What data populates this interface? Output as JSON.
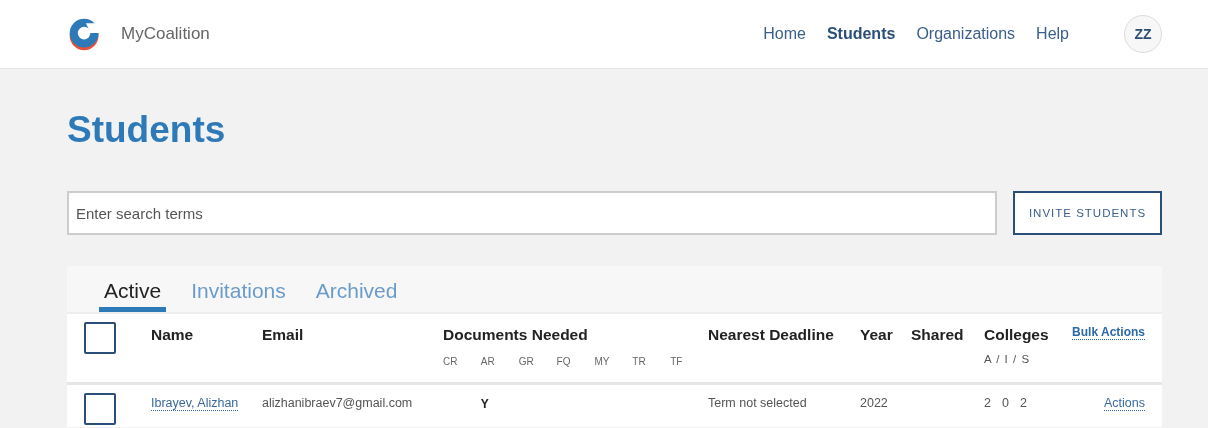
{
  "header": {
    "brand": "MyCoalition",
    "nav": [
      {
        "label": "Home",
        "selected": false
      },
      {
        "label": "Students",
        "selected": true
      },
      {
        "label": "Organizations",
        "selected": false
      },
      {
        "label": "Help",
        "selected": false
      }
    ],
    "avatar": "ZZ"
  },
  "page_title": "Students",
  "search": {
    "placeholder": "Enter search terms"
  },
  "invite_button": "INVITE STUDENTS",
  "tabs": [
    {
      "label": "Active",
      "selected": true
    },
    {
      "label": "Invitations",
      "selected": false
    },
    {
      "label": "Archived",
      "selected": false
    }
  ],
  "table": {
    "select_all_checked": false,
    "columns": {
      "name": "Name",
      "email": "Email",
      "documents": "Documents Needed",
      "document_codes": [
        "CR",
        "AR",
        "GR",
        "FQ",
        "MY",
        "TR",
        "TF"
      ],
      "deadline": "Nearest Deadline",
      "year": "Year",
      "shared": "Shared",
      "colleges": "Colleges",
      "colleges_sub": "A / I / S",
      "bulk": "Bulk Actions"
    },
    "rows": [
      {
        "checked": false,
        "name": "Ibrayev, Alizhan",
        "email": "alizhanibraev7@gmail.com",
        "documents": {
          "column_2": "Y"
        },
        "deadline": "Term not selected",
        "year": "2022",
        "colleges": [
          "2",
          "0",
          "2"
        ],
        "action": "Actions"
      }
    ]
  }
}
